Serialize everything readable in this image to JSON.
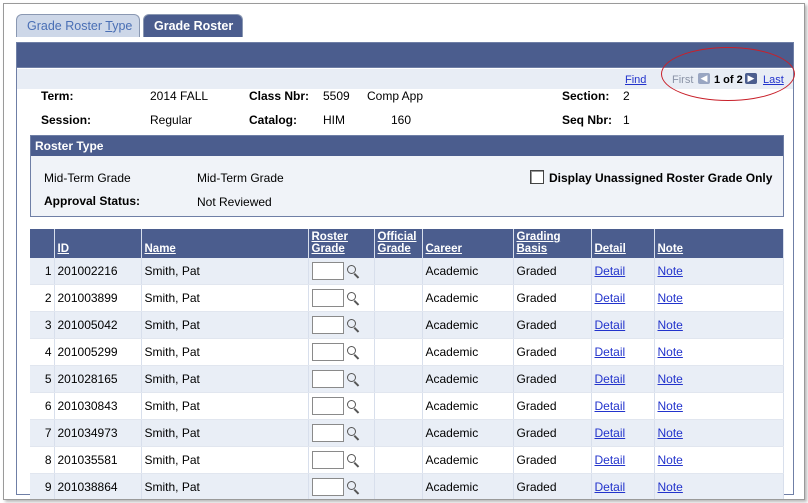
{
  "tabs": {
    "grade_roster_type_pre": "Grade Roster ",
    "grade_roster_type_u": "T",
    "grade_roster_type_post": "ype",
    "grade_roster": "Grade Roster"
  },
  "nav": {
    "find": "Find",
    "first": "First",
    "page_info": "1 of 2",
    "last": "Last",
    "prev_icon": "arrow-left-icon",
    "next_icon": "arrow-right-icon"
  },
  "header": {
    "term_label": "Term:",
    "term_value": "2014 FALL",
    "class_nbr_label": "Class Nbr:",
    "class_nbr_value": "5509",
    "class_desc": "Comp App",
    "section_label": "Section:",
    "section_value": "2",
    "session_label": "Session:",
    "session_value": "Regular",
    "catalog_label": "Catalog:",
    "catalog_subject": "HIM",
    "catalog_number": "160",
    "seq_nbr_label": "Seq Nbr:",
    "seq_nbr_value": "1"
  },
  "roster_type": {
    "title": "Roster Type",
    "type_label": "Mid-Term Grade",
    "type_value": "Mid-Term Grade",
    "approval_label": "Approval Status:",
    "approval_value": "Not Reviewed",
    "unassigned_checkbox_label": "Display Unassigned Roster Grade Only",
    "unassigned_checked": false
  },
  "grid": {
    "columns": {
      "id": "ID",
      "name": "Name",
      "roster_grade_1": "Roster",
      "roster_grade_2": "Grade",
      "official_grade_1": "Official",
      "official_grade_2": "Grade",
      "career": "Career",
      "grading_basis": "Grading Basis",
      "detail": "Detail",
      "note": "Note"
    },
    "rows": [
      {
        "num": "1",
        "id": "201002216",
        "name": "Smith, Pat",
        "career": "Academic",
        "basis": "Graded",
        "detail": "Detail",
        "note": "Note"
      },
      {
        "num": "2",
        "id": "201003899",
        "name": "Smith, Pat",
        "career": "Academic",
        "basis": "Graded",
        "detail": "Detail",
        "note": "Note"
      },
      {
        "num": "3",
        "id": "201005042",
        "name": "Smith, Pat",
        "career": "Academic",
        "basis": "Graded",
        "detail": "Detail",
        "note": "Note"
      },
      {
        "num": "4",
        "id": "201005299",
        "name": "Smith, Pat",
        "career": "Academic",
        "basis": "Graded",
        "detail": "Detail",
        "note": "Note"
      },
      {
        "num": "5",
        "id": "201028165",
        "name": "Smith, Pat",
        "career": "Academic",
        "basis": "Graded",
        "detail": "Detail",
        "note": "Note"
      },
      {
        "num": "6",
        "id": "201030843",
        "name": "Smith, Pat",
        "career": "Academic",
        "basis": "Graded",
        "detail": "Detail",
        "note": "Note"
      },
      {
        "num": "7",
        "id": "201034973",
        "name": "Smith, Pat",
        "career": "Academic",
        "basis": "Graded",
        "detail": "Detail",
        "note": "Note"
      },
      {
        "num": "8",
        "id": "201035581",
        "name": "Smith, Pat",
        "career": "Academic",
        "basis": "Graded",
        "detail": "Detail",
        "note": "Note"
      },
      {
        "num": "9",
        "id": "201038864",
        "name": "Smith, Pat",
        "career": "Academic",
        "basis": "Graded",
        "detail": "Detail",
        "note": "Note"
      }
    ]
  },
  "colors": {
    "header_blue": "#4b5d8e",
    "link": "#2233cc",
    "highlight_oval": "#c8202a"
  }
}
